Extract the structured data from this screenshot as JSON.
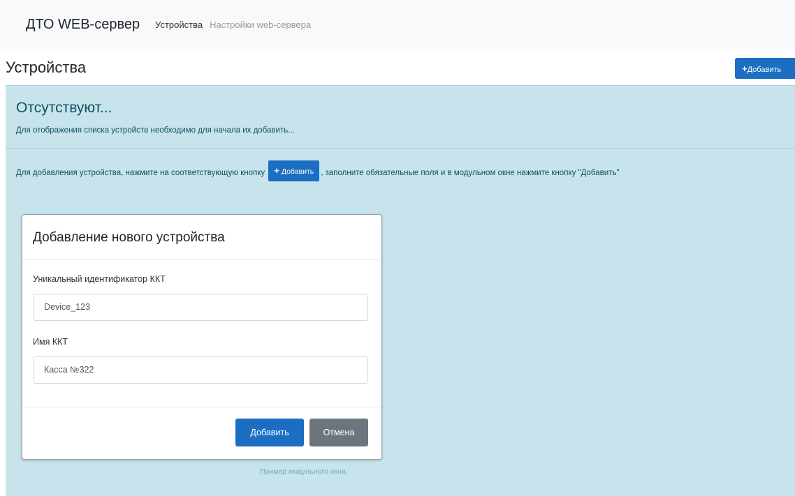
{
  "navbar": {
    "brand": "ДТО WEB-сервер",
    "links": [
      {
        "label": "Устройства"
      },
      {
        "label": "Настройки web-сервера"
      }
    ]
  },
  "page": {
    "title": "Устройства",
    "add_button_label": "Добавить"
  },
  "alert": {
    "heading": "Отсутствуют...",
    "description": "Для отображения списка устройств необходимо для начала их добавить...",
    "instruction_before": "Для добавления устройства, нажмите на соответствующую кнопку",
    "inline_button_label": "Добавить",
    "instruction_after": ", заполните обязательные поля и в модульном окне нажмите кнопку \"Добавить\""
  },
  "modal": {
    "title": "Добавление нового устройства",
    "fields": [
      {
        "label": "Уникальный идентификатор ККТ",
        "value": "Device_123"
      },
      {
        "label": "Имя ККТ",
        "value": "Касса №322"
      }
    ],
    "submit_label": "Добавить",
    "cancel_label": "Отмена"
  },
  "caption": "Пример модульного окна.",
  "colors": {
    "primary": "#1b6ec2",
    "secondary": "#6c757d",
    "alert_bg": "#c7e3eb",
    "alert_text": "#0c5460"
  },
  "icons": {
    "plus": "plus-icon"
  }
}
